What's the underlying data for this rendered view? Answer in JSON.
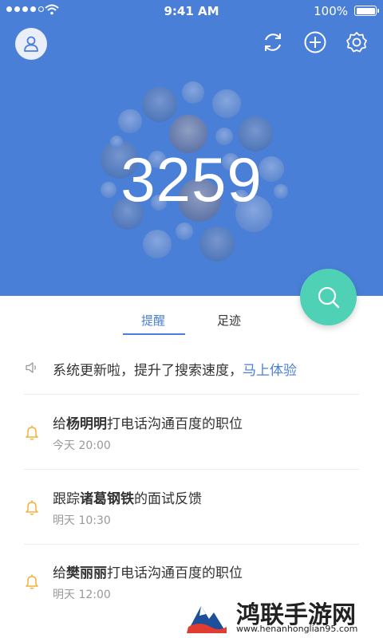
{
  "status_bar": {
    "time": "9:41 AM",
    "battery": "100%"
  },
  "header": {
    "count": "3259",
    "icons": [
      "user-icon",
      "refresh-icon",
      "add-icon",
      "settings-icon"
    ]
  },
  "tabs": [
    {
      "label": "提醒",
      "active": true
    },
    {
      "label": "足迹",
      "active": false
    }
  ],
  "announcement": {
    "text": "系统更新啦，提升了搜索速度，",
    "link": "马上体验"
  },
  "reminders": [
    {
      "prefix": "给",
      "name": "杨明明",
      "suffix": "打电话沟通百度的职位",
      "time": "今天 20:00"
    },
    {
      "prefix": "跟踪",
      "name": "诸葛钢铁",
      "suffix": "的面试反馈",
      "time": "明天 10:30"
    },
    {
      "prefix": "给",
      "name": "樊丽丽",
      "suffix": "打电话沟通百度的职位",
      "time": "明天 12:00"
    }
  ],
  "watermark": {
    "brand": "鸿联手游网",
    "domain": "www.henanhonglian95.com"
  },
  "colors": {
    "primary": "#4a7fd8",
    "fab": "#4fd1b5",
    "bell": "#f0b23c",
    "link": "#4a7fd8"
  }
}
